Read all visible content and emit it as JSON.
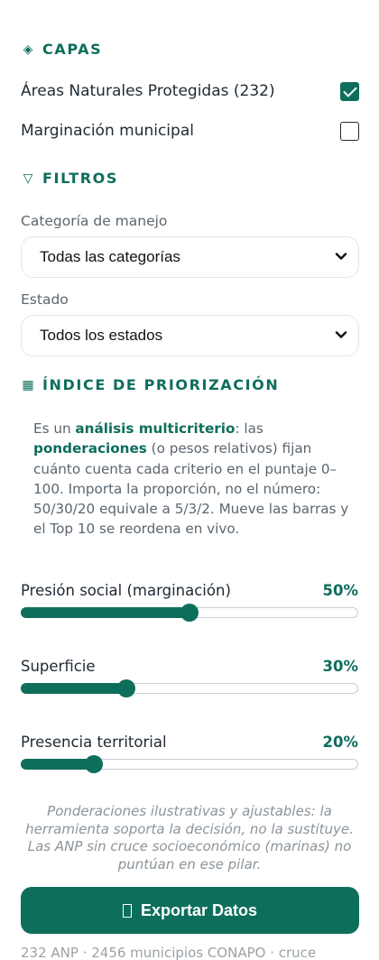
{
  "layers": {
    "title": "CAPAS",
    "icon": "diamond-icon",
    "items": [
      {
        "label": "Áreas Naturales Protegidas (232)",
        "checked": true
      },
      {
        "label": "Marginación municipal",
        "checked": false
      }
    ]
  },
  "filters": {
    "title": "FILTROS",
    "icon": "funnel-icon",
    "category_label": "Categoría de manejo",
    "category_value": "Todas las categorías",
    "state_label": "Estado",
    "state_value": "Todos los estados"
  },
  "priority": {
    "title": "ÍNDICE DE PRIORIZACIÓN",
    "icon": "grid-icon",
    "desc_1": "Es un ",
    "desc_bold_1": "análisis multicriterio",
    "desc_2": ": las ",
    "desc_bold_2": "ponderaciones",
    "desc_3": " (o pesos relativos) fijan cuánto cuenta cada criterio en el puntaje 0–100. Importa la proporción, no el número: 50/30/20 equivale a 5/3/2. Mueve las barras y el Top 10 se reordena en vivo.",
    "sliders": [
      {
        "label": "Presión social (marginación)",
        "value_text": "50%",
        "value": 50
      },
      {
        "label": "Superficie",
        "value_text": "30%",
        "value": 30
      },
      {
        "label": "Presencia territorial",
        "value_text": "20%",
        "value": 20
      }
    ],
    "note": "Ponderaciones ilustrativas y ajustables: la herramienta soporta la decisión, no la sustituye. Las ANP sin cruce socioeconómico (marinas) no puntúan en ese pilar."
  },
  "export": {
    "label": "Exportar Datos",
    "icon": "file-icon"
  },
  "footer": "232 ANP · 2456 municipios CONAPO · cruce",
  "colors": {
    "accent": "#0e6e5c",
    "text": "#1f2933",
    "muted": "#5b6670"
  }
}
